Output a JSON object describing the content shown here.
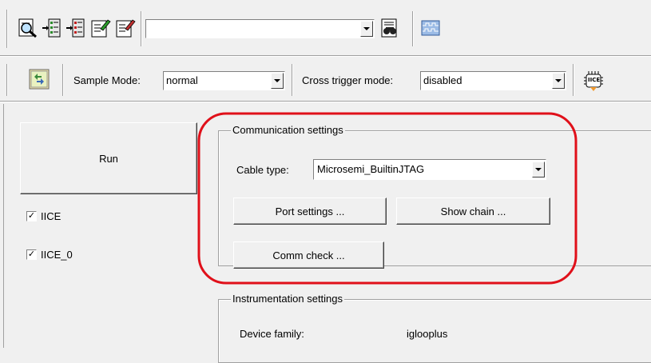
{
  "toolbar": {
    "search_combo_value": "",
    "buttons": [
      "open-file-icon",
      "add-instrument-icon",
      "remove-instrument-icon",
      "edit-trigger-icon",
      "edit-watch-icon",
      "find-icon",
      "waveform-icon"
    ]
  },
  "sampling": {
    "sample_mode_label": "Sample Mode:",
    "sample_mode_value": "normal",
    "cross_trigger_label": "Cross trigger mode:",
    "cross_trigger_value": "disabled",
    "iice_badge": "IICE"
  },
  "left_panel": {
    "run_label": "Run",
    "checkboxes": [
      {
        "label": "IICE",
        "checked": true,
        "mark": "✓"
      },
      {
        "label": "IICE_0",
        "checked": true,
        "mark": "✓"
      }
    ]
  },
  "communication": {
    "title": "Communication settings",
    "cable_type_label": "Cable type:",
    "cable_type_value": "Microsemi_BuiltinJTAG",
    "port_settings_label": "Port settings ...",
    "show_chain_label": "Show chain ...",
    "comm_check_label": "Comm check ..."
  },
  "instrumentation": {
    "title": "Instrumentation settings",
    "device_family_label": "Device family:",
    "device_family_value": "iglooplus"
  },
  "colors": {
    "highlight_outline": "#e0101a",
    "window_bg": "#f0f0f0"
  }
}
